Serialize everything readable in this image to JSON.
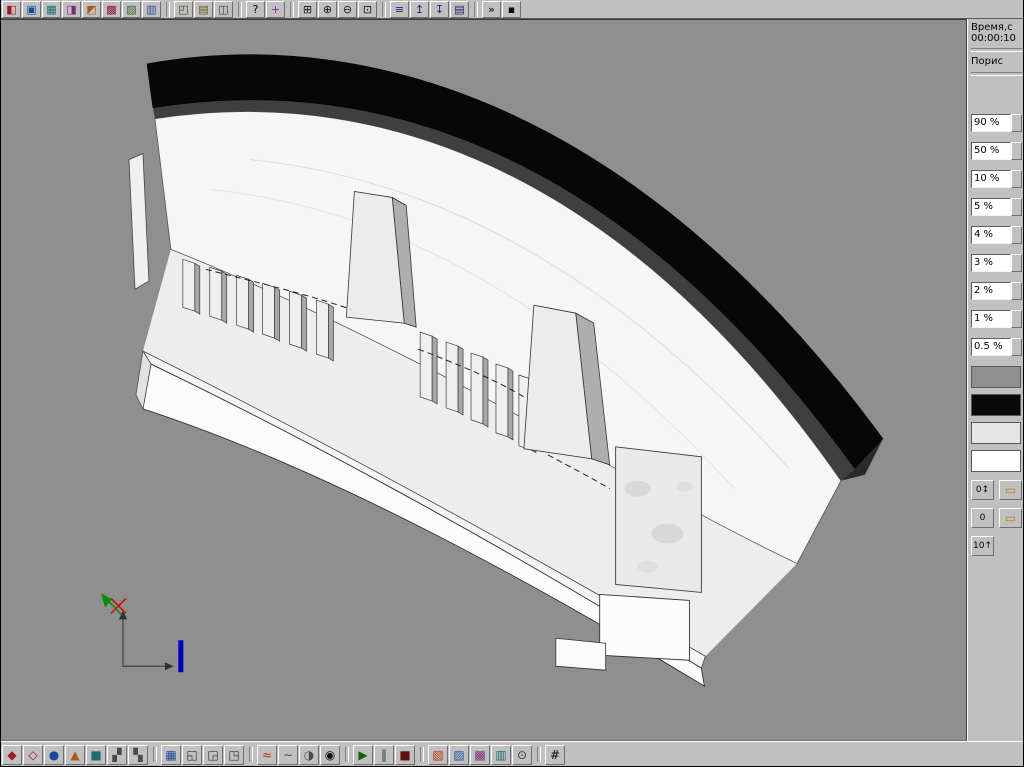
{
  "app": {
    "viewport_bg": "#8f8f8f",
    "chrome_bg": "#c0c0c0"
  },
  "right_panel": {
    "time_label": "Время,с",
    "time_value": "00:00:10",
    "param_label": "Порис",
    "scale": [
      {
        "kind": "field",
        "label": "90 %"
      },
      {
        "kind": "field",
        "label": "50 %"
      },
      {
        "kind": "field",
        "label": "10 %"
      },
      {
        "kind": "field",
        "label": "5 %"
      },
      {
        "kind": "field",
        "label": "4 %"
      },
      {
        "kind": "field",
        "label": "3 %"
      },
      {
        "kind": "field",
        "label": "2 %"
      },
      {
        "kind": "field",
        "label": "1 %"
      },
      {
        "kind": "field",
        "label": "0.5 %"
      }
    ],
    "swatches": [
      {
        "kind": "swatch",
        "name": "legend-swatch-gray",
        "color": "#8f8f8f"
      },
      {
        "kind": "swatch",
        "name": "legend-swatch-black",
        "color": "#0a0a0a"
      },
      {
        "kind": "swatch",
        "name": "legend-swatch-lightgray",
        "color": "#e6e6e6"
      },
      {
        "kind": "swatch",
        "name": "legend-swatch-white",
        "color": "#ffffff"
      }
    ],
    "controls": {
      "spin_zero": "0↕",
      "folder1": "▭",
      "zero": "0",
      "folder2": "▭",
      "ten": "10↑"
    }
  },
  "toolbar_top": {
    "items": [
      {
        "kind": "btn",
        "name": "new-project",
        "glyph": "◧",
        "color": "#a01818"
      },
      {
        "kind": "btn",
        "name": "open-project",
        "glyph": "▣",
        "color": "#184a9c"
      },
      {
        "kind": "btn",
        "name": "save-project",
        "glyph": "▦",
        "color": "#1a6e6e"
      },
      {
        "kind": "btn",
        "name": "import-geometry",
        "glyph": "◨",
        "color": "#7a2a7a"
      },
      {
        "kind": "btn",
        "name": "export-geometry",
        "glyph": "◩",
        "color": "#b05a10"
      },
      {
        "kind": "btn",
        "name": "mesh-generator",
        "glyph": "▩",
        "color": "#8a1a3a"
      },
      {
        "kind": "btn",
        "name": "material-database",
        "glyph": "▨",
        "color": "#3a6a1a"
      },
      {
        "kind": "btn",
        "name": "color-palette",
        "glyph": "▥",
        "color": "#2a4ab0"
      },
      {
        "kind": "sep"
      },
      {
        "kind": "btn",
        "name": "view-cube",
        "glyph": "◰",
        "color": "#50401a"
      },
      {
        "kind": "btn",
        "name": "layer-manager",
        "glyph": "▤",
        "color": "#6a5a10"
      },
      {
        "kind": "btn",
        "name": "settings",
        "glyph": "◫",
        "color": "#3a3a3a"
      },
      {
        "kind": "sep"
      },
      {
        "kind": "btn",
        "name": "help",
        "glyph": "?",
        "color": "#000000"
      },
      {
        "kind": "btn",
        "name": "pick-probe",
        "glyph": "+",
        "color": "#8a2aa0"
      },
      {
        "kind": "sep"
      },
      {
        "kind": "btn",
        "name": "zoom-window",
        "glyph": "⊞",
        "color": "#1a1a1a"
      },
      {
        "kind": "btn",
        "name": "zoom-in",
        "glyph": "⊕",
        "color": "#1a1a1a"
      },
      {
        "kind": "btn",
        "name": "zoom-out",
        "glyph": "⊖",
        "color": "#1a1a1a"
      },
      {
        "kind": "btn",
        "name": "zoom-fit",
        "glyph": "⊡",
        "color": "#1a1a1a"
      },
      {
        "kind": "sep"
      },
      {
        "kind": "btn",
        "name": "results-list",
        "glyph": "≡",
        "color": "#22226a"
      },
      {
        "kind": "btn",
        "name": "scale-up",
        "glyph": "↥",
        "color": "#22226a"
      },
      {
        "kind": "btn",
        "name": "scale-down",
        "glyph": "↧",
        "color": "#22226a"
      },
      {
        "kind": "btn",
        "name": "results-table",
        "glyph": "▤",
        "color": "#22226a"
      },
      {
        "kind": "sep"
      },
      {
        "kind": "btn",
        "name": "fast-forward",
        "glyph": "»",
        "color": "#000000"
      },
      {
        "kind": "btn",
        "name": "record",
        "glyph": "▪",
        "color": "#000000"
      }
    ]
  },
  "toolbar_bottom": {
    "items": [
      {
        "kind": "btn",
        "name": "cavity",
        "glyph": "◆",
        "color": "#a01818"
      },
      {
        "kind": "btn",
        "name": "mold",
        "glyph": "◇",
        "color": "#a01818"
      },
      {
        "kind": "btn",
        "name": "gating",
        "glyph": "●",
        "color": "#184a9c"
      },
      {
        "kind": "btn",
        "name": "riser",
        "glyph": "▲",
        "color": "#b05a10"
      },
      {
        "kind": "btn",
        "name": "core",
        "glyph": "■",
        "color": "#1a6e6e"
      },
      {
        "kind": "btn",
        "name": "chill",
        "glyph": "▞",
        "color": "#4a4a4a"
      },
      {
        "kind": "btn",
        "name": "insulation",
        "glyph": "▚",
        "color": "#4a4a4a"
      },
      {
        "kind": "sep"
      },
      {
        "kind": "btn",
        "name": "mesh-view",
        "glyph": "▦",
        "color": "#184a9c"
      },
      {
        "kind": "btn",
        "name": "slice-x",
        "glyph": "◱",
        "color": "#333333"
      },
      {
        "kind": "btn",
        "name": "slice-y",
        "glyph": "◲",
        "color": "#333333"
      },
      {
        "kind": "btn",
        "name": "slice-z",
        "glyph": "◳",
        "color": "#333333"
      },
      {
        "kind": "sep"
      },
      {
        "kind": "btn",
        "name": "temperature-field",
        "glyph": "≈",
        "color": "#c03010"
      },
      {
        "kind": "btn",
        "name": "flow-field",
        "glyph": "∼",
        "color": "#2050b0"
      },
      {
        "kind": "btn",
        "name": "solid-fraction",
        "glyph": "◑",
        "color": "#4a4a4a"
      },
      {
        "kind": "btn",
        "name": "shrinkage",
        "glyph": "◉",
        "color": "#111111"
      },
      {
        "kind": "sep"
      },
      {
        "kind": "btn",
        "name": "play-simulation",
        "glyph": "▶",
        "color": "#106010"
      },
      {
        "kind": "btn",
        "name": "pause-simulation",
        "glyph": "‖",
        "color": "#106010"
      },
      {
        "kind": "btn",
        "name": "stop-simulation",
        "glyph": "■",
        "color": "#601010"
      },
      {
        "kind": "sep"
      },
      {
        "kind": "btn",
        "name": "result-temperature",
        "glyph": "▧",
        "color": "#c03010"
      },
      {
        "kind": "btn",
        "name": "result-flow",
        "glyph": "▨",
        "color": "#2050b0"
      },
      {
        "kind": "btn",
        "name": "result-porosity",
        "glyph": "▩",
        "color": "#7a2a7a"
      },
      {
        "kind": "btn",
        "name": "result-stress",
        "glyph": "▥",
        "color": "#1a6e6e"
      },
      {
        "kind": "btn",
        "name": "result-time",
        "glyph": "⊙",
        "color": "#333333"
      },
      {
        "kind": "sep"
      },
      {
        "kind": "btn",
        "name": "grid-toggle",
        "glyph": "#",
        "color": "#000000"
      }
    ]
  }
}
